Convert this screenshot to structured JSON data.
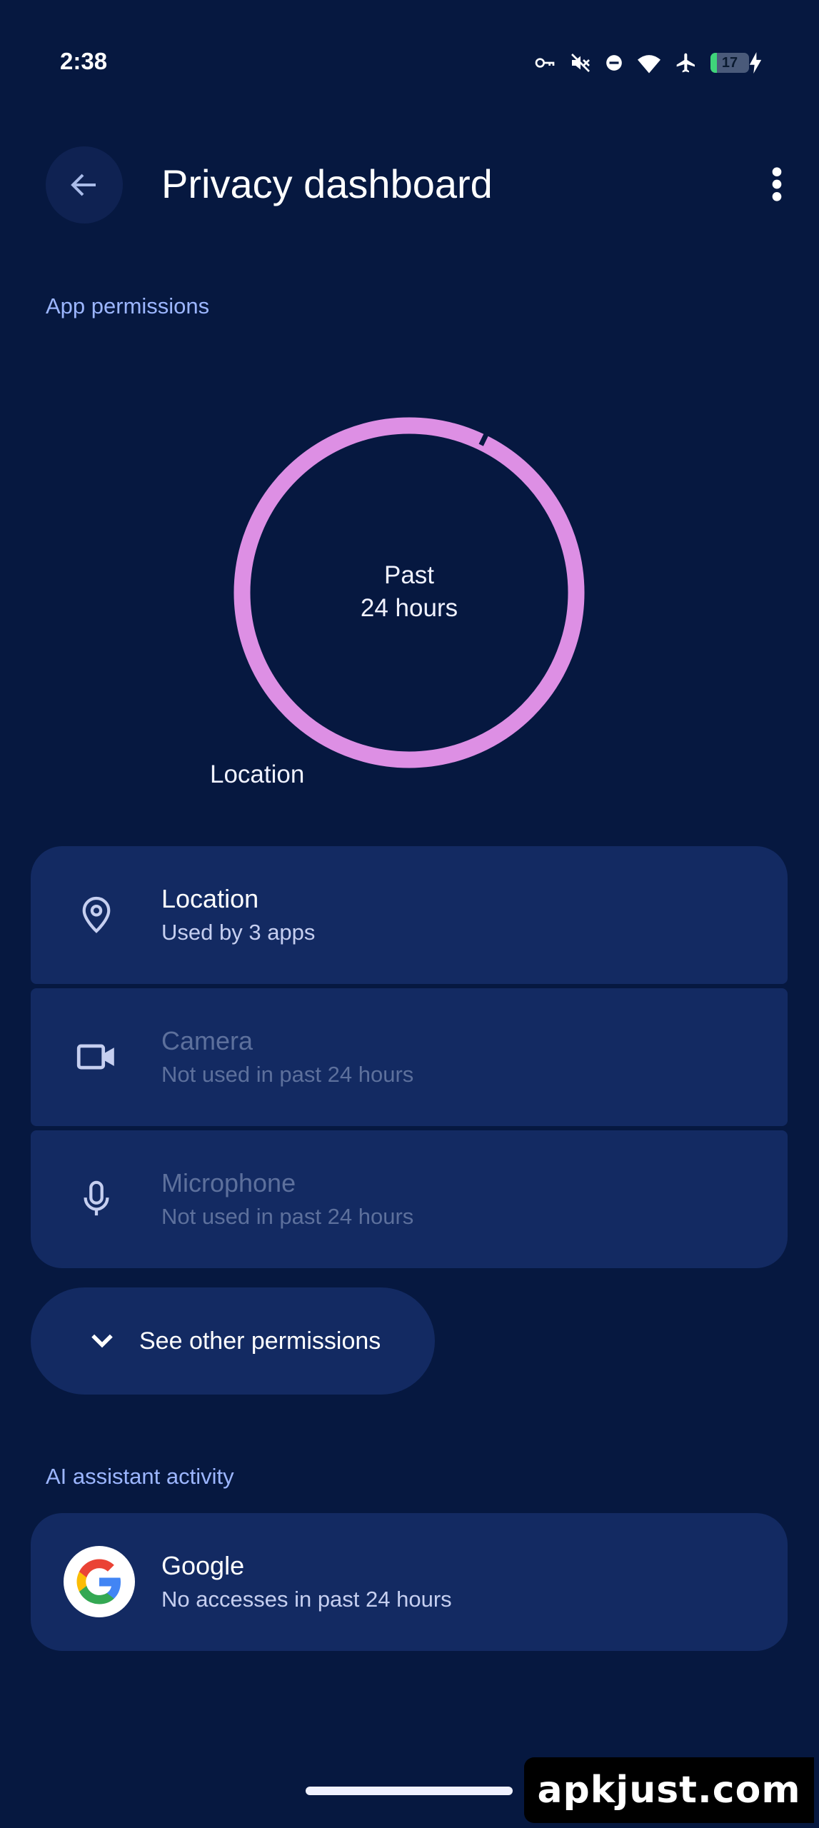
{
  "status_bar": {
    "time": "2:38",
    "battery_level": "17",
    "battery_fraction": 0.17,
    "icons": [
      "vpn-key-icon",
      "vibrate-off-icon",
      "do-not-disturb-icon",
      "wifi-icon",
      "airplane-mode-icon",
      "battery-icon",
      "charging-bolt-icon"
    ]
  },
  "header": {
    "title": "Privacy dashboard",
    "back_icon": "arrow-back-icon",
    "more_icon": "more-vert-icon"
  },
  "app_permissions": {
    "section_label": "App permissions",
    "chart": {
      "center_line1": "Past",
      "center_line2": "24 hours",
      "legend_label": "Location",
      "color": "#dd8fe4"
    },
    "items": [
      {
        "title": "Location",
        "subtitle": "Used by 3 apps",
        "icon": "location-pin-icon",
        "enabled": true
      },
      {
        "title": "Camera",
        "subtitle": "Not used in past 24 hours",
        "icon": "videocam-icon",
        "enabled": false
      },
      {
        "title": "Microphone",
        "subtitle": "Not used in past 24 hours",
        "icon": "mic-icon",
        "enabled": false
      }
    ],
    "see_other_label": "See other permissions",
    "see_other_icon": "chevron-down-icon"
  },
  "ai_assistant": {
    "section_label": "AI assistant activity",
    "items": [
      {
        "title": "Google",
        "subtitle": "No accesses in past 24 hours",
        "icon": "google-logo-icon"
      }
    ]
  },
  "watermark": "apkjust.com",
  "colors": {
    "background": "#061840",
    "card": "#132a62",
    "accent_label": "#9cb6ff",
    "chart_ring": "#dd8fe4"
  }
}
